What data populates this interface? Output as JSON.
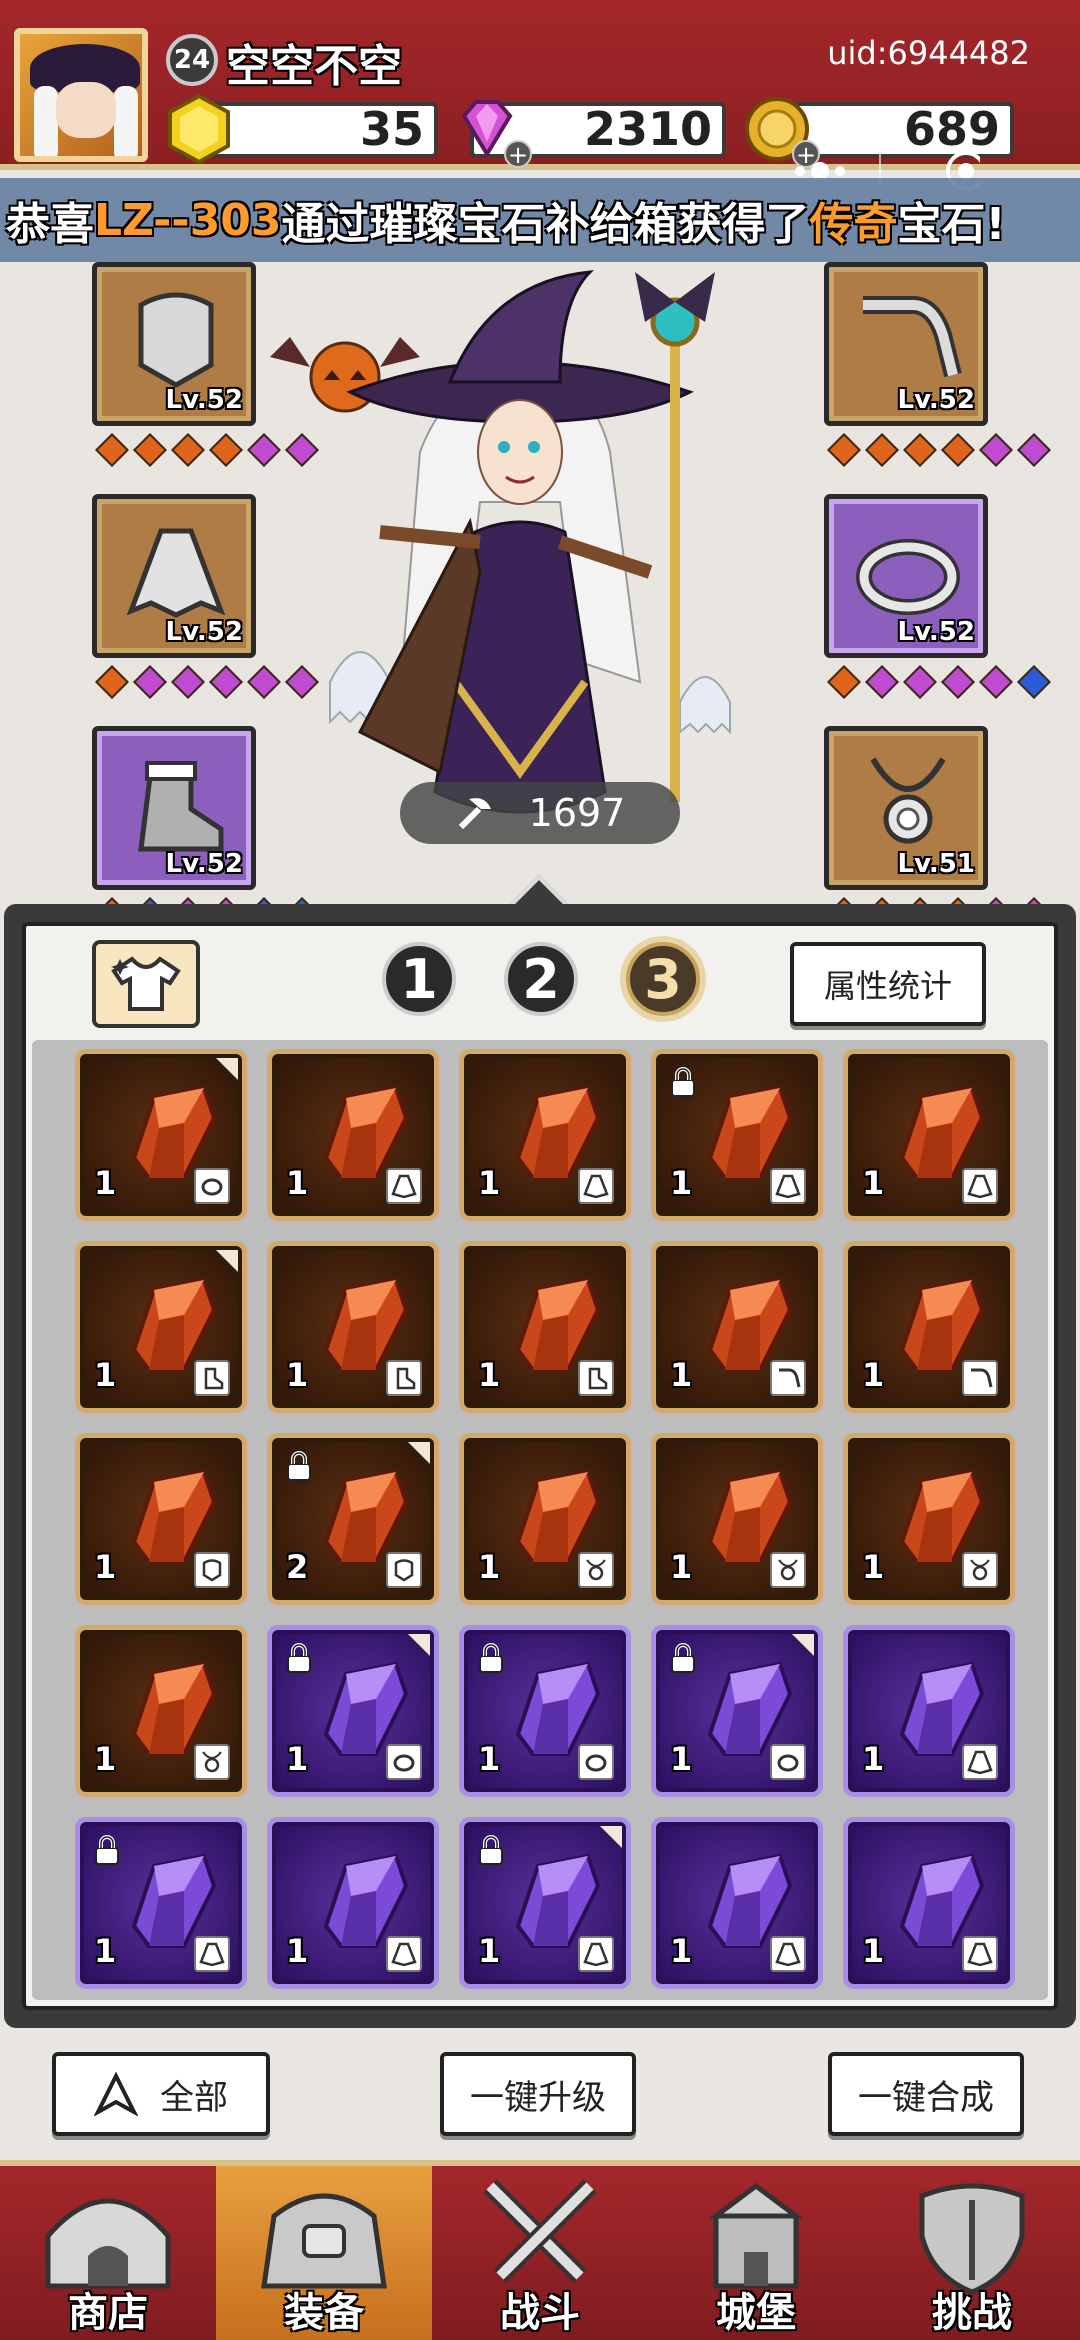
{
  "player": {
    "level": "24",
    "name": "空空不空",
    "uid": "uid:6944482"
  },
  "resources": {
    "gold_gem": "35",
    "diamond": "2310",
    "coin": "689"
  },
  "banner": {
    "prefix": "恭喜",
    "player": "LZ--303",
    "middle": "通过璀璨宝石补给箱获得了",
    "rarity": "传奇",
    "suffix": "宝石!"
  },
  "equipment": {
    "left": [
      {
        "icon": "helmet-icon",
        "level": "Lv.52",
        "rarity": "gold"
      },
      {
        "icon": "cloak-icon",
        "level": "Lv.52",
        "rarity": "gold"
      },
      {
        "icon": "boot-icon",
        "level": "Lv.52",
        "rarity": "purple"
      }
    ],
    "right": [
      {
        "icon": "pipe-icon",
        "level": "Lv.52",
        "rarity": "gold"
      },
      {
        "icon": "ring-icon",
        "level": "Lv.52",
        "rarity": "purple"
      },
      {
        "icon": "necklace-icon",
        "level": "Lv.51",
        "rarity": "gold"
      }
    ],
    "power": "1697"
  },
  "bag": {
    "pages": [
      "1",
      "2",
      "3"
    ],
    "active_page": "3",
    "stats_label": "属性统计",
    "rows": [
      [
        {
          "type": "orange",
          "count": "1",
          "slot": "ring",
          "locked": false,
          "corner": true
        },
        {
          "type": "orange",
          "count": "1",
          "slot": "cloak",
          "locked": false,
          "corner": false
        },
        {
          "type": "orange",
          "count": "1",
          "slot": "cloak",
          "locked": false,
          "corner": false
        },
        {
          "type": "orange",
          "count": "1",
          "slot": "cloak",
          "locked": true,
          "corner": false
        },
        {
          "type": "orange",
          "count": "1",
          "slot": "cloak",
          "locked": false,
          "corner": false
        }
      ],
      [
        {
          "type": "orange",
          "count": "1",
          "slot": "boot",
          "locked": false,
          "corner": true
        },
        {
          "type": "orange",
          "count": "1",
          "slot": "boot",
          "locked": false,
          "corner": false
        },
        {
          "type": "orange",
          "count": "1",
          "slot": "boot",
          "locked": false,
          "corner": false
        },
        {
          "type": "orange",
          "count": "1",
          "slot": "pipe",
          "locked": false,
          "corner": false
        },
        {
          "type": "orange",
          "count": "1",
          "slot": "pipe",
          "locked": false,
          "corner": false
        }
      ],
      [
        {
          "type": "orange",
          "count": "1",
          "slot": "helmet",
          "locked": false,
          "corner": false
        },
        {
          "type": "orange",
          "count": "2",
          "slot": "helmet",
          "locked": true,
          "corner": true
        },
        {
          "type": "orange",
          "count": "1",
          "slot": "necklace",
          "locked": false,
          "corner": false
        },
        {
          "type": "orange",
          "count": "1",
          "slot": "necklace",
          "locked": false,
          "corner": false
        },
        {
          "type": "orange",
          "count": "1",
          "slot": "necklace",
          "locked": false,
          "corner": false
        }
      ],
      [
        {
          "type": "orange",
          "count": "1",
          "slot": "necklace",
          "locked": false,
          "corner": false
        },
        {
          "type": "purple",
          "count": "1",
          "slot": "ring",
          "locked": true,
          "corner": true
        },
        {
          "type": "purple",
          "count": "1",
          "slot": "ring",
          "locked": true,
          "corner": false
        },
        {
          "type": "purple",
          "count": "1",
          "slot": "ring",
          "locked": true,
          "corner": true
        },
        {
          "type": "purple",
          "count": "1",
          "slot": "cloak",
          "locked": false,
          "corner": false
        }
      ],
      [
        {
          "type": "purple",
          "count": "1",
          "slot": "cloak",
          "locked": true,
          "corner": false
        },
        {
          "type": "purple",
          "count": "1",
          "slot": "cloak",
          "locked": false,
          "corner": false
        },
        {
          "type": "purple",
          "count": "1",
          "slot": "cloak",
          "locked": true,
          "corner": true
        },
        {
          "type": "purple",
          "count": "1",
          "slot": "cloak",
          "locked": false,
          "corner": false
        },
        {
          "type": "purple",
          "count": "1",
          "slot": "cloak",
          "locked": false,
          "corner": false
        }
      ]
    ]
  },
  "actions": {
    "filter_label": "全部",
    "upgrade_label": "一键升级",
    "merge_label": "一键合成"
  },
  "nav": [
    {
      "label": "商店",
      "icon": "shop-icon",
      "active": false
    },
    {
      "label": "装备",
      "icon": "bag-icon",
      "active": true
    },
    {
      "label": "战斗",
      "icon": "swords-icon",
      "active": false
    },
    {
      "label": "城堡",
      "icon": "castle-icon",
      "active": false
    },
    {
      "label": "挑战",
      "icon": "shield-icon",
      "active": false
    }
  ],
  "colors": {
    "header_red": "#a3272a",
    "highlight_orange": "#ff9a2e",
    "gold_frame": "#d6a96a",
    "purple_frame": "#a98ce6"
  }
}
